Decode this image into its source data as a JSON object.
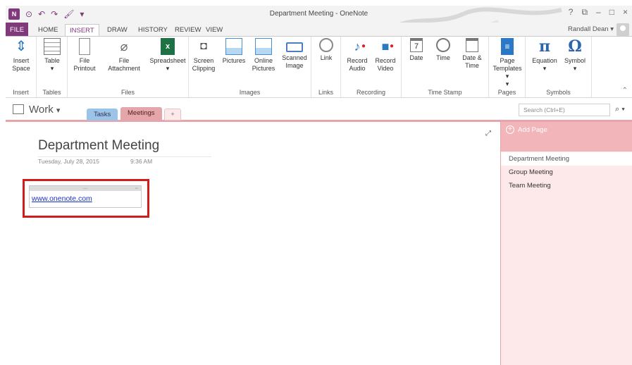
{
  "window": {
    "title": "Department Meeting - OneNote",
    "controls": [
      "?",
      "⧉",
      "–",
      "□",
      "×"
    ]
  },
  "quick_access": [
    "N",
    "⊙",
    "↶",
    "↷",
    "🖌",
    "▾"
  ],
  "tabs": [
    "FILE",
    "HOME",
    "INSERT",
    "DRAW",
    "HISTORY",
    "REVIEW",
    "VIEW"
  ],
  "active_tab": "INSERT",
  "account": {
    "name": "Randall Dean",
    "caret": "▾"
  },
  "ribbon": {
    "groups": {
      "insert": "Insert",
      "tables": "Tables",
      "files": "Files",
      "images": "Images",
      "links": "Links",
      "recording": "Recording",
      "timestamp": "Time Stamp",
      "pages": "Pages",
      "symbols": "Symbols"
    },
    "buttons": {
      "insert_space_1": "Insert",
      "insert_space_2": "Space",
      "table_1": "Table",
      "table_2": "▾",
      "file_printout_1": "File",
      "file_printout_2": "Printout",
      "file_attachment_1": "File",
      "file_attachment_2": "Attachment",
      "spreadsheet_1": "Spreadsheet",
      "spreadsheet_2": "▾",
      "screen_clipping_1": "Screen",
      "screen_clipping_2": "Clipping",
      "pictures_1": "Pictures",
      "online_pictures_1": "Online",
      "online_pictures_2": "Pictures",
      "scanned_image_1": "Scanned",
      "scanned_image_2": "Image",
      "link_1": "Link",
      "record_audio_1": "Record",
      "record_audio_2": "Audio",
      "record_video_1": "Record",
      "record_video_2": "Video",
      "date_1": "Date",
      "time_1": "Time",
      "date_time_1": "Date &",
      "date_time_2": "Time",
      "page_templates_1": "Page",
      "page_templates_2": "Templates ▾",
      "page_templates_3": "▾",
      "equation_1": "Equation",
      "equation_2": "▾",
      "symbol_1": "Symbol",
      "symbol_2": "▾"
    },
    "icons": {
      "calendar_day": "7",
      "pi": "π",
      "omega": "Ω",
      "excel": "x",
      "page": "≡"
    }
  },
  "notebook": {
    "name": "Work",
    "caret": "▾",
    "sections": [
      "Tasks",
      "Meetings",
      "+"
    ],
    "active_section": "Meetings"
  },
  "search": {
    "placeholder": "Search (Ctrl+E)",
    "icon": "⌕ ▾"
  },
  "page": {
    "title": "Department Meeting",
    "date": "Tuesday, July 28, 2015",
    "time": "9:36 AM",
    "note_handle": "....",
    "note_resize": "↔",
    "link": "www.onenote.com"
  },
  "pages_pane": {
    "add_page": "Add Page",
    "add_icon": "+",
    "items": [
      "Department Meeting",
      "Group Meeting",
      "Team Meeting"
    ],
    "selected": "Department Meeting"
  },
  "colors": {
    "brand": "#80397b",
    "section_meetings": "#e5a6ab",
    "section_tasks": "#9bc4e8",
    "pages_bg": "#fde9ea",
    "highlight_frame": "#d11c1c",
    "link": "#1b33c9"
  }
}
